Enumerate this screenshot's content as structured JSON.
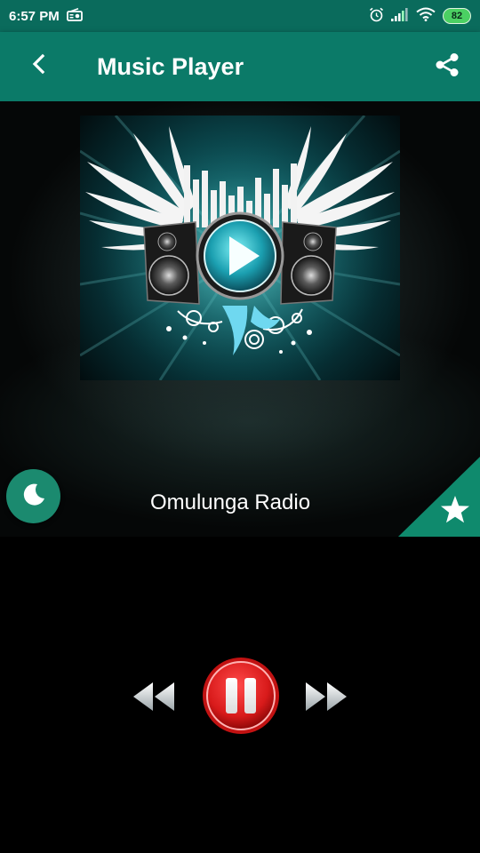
{
  "status_bar": {
    "time": "6:57 PM",
    "battery": "82",
    "icons": [
      "radio-icon",
      "alarm-icon",
      "signal-icon",
      "wifi-icon",
      "battery-icon"
    ]
  },
  "app_bar": {
    "title": "Music Player",
    "back_icon": "back-arrow-icon",
    "share_icon": "share-icon",
    "background": "#0b7a68"
  },
  "player": {
    "station_name": "Omulunga Radio",
    "artwork": "speakers-wings-play-artwork",
    "sleep_icon": "moon-icon",
    "favorite_icon": "star-icon",
    "accent": "#1b8a6f"
  },
  "controls": {
    "rewind_icon": "rewind-icon",
    "pause_icon": "pause-icon",
    "forward_icon": "fast-forward-icon",
    "pause_color": "#d81a1a"
  }
}
